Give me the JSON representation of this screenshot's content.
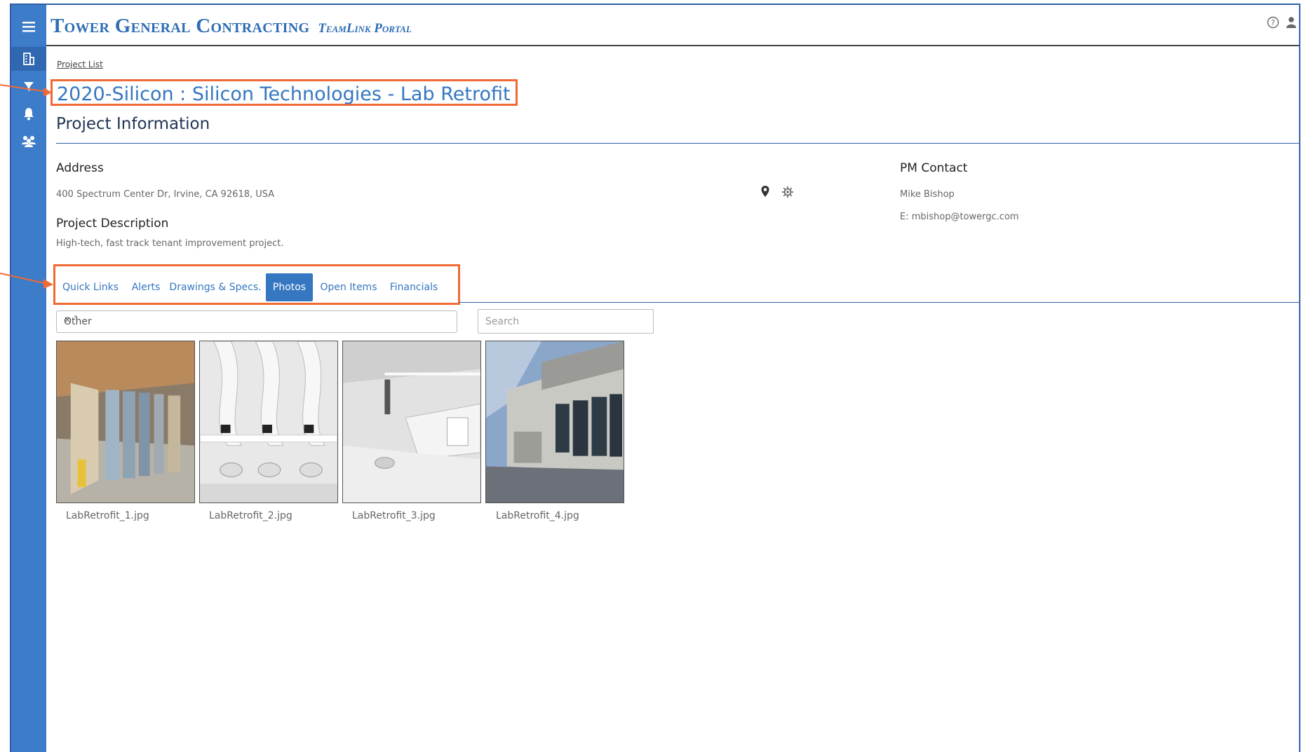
{
  "app": {
    "brand_main": "Tower General Contracting",
    "brand_sub": "TeamLink Portal"
  },
  "sidebar": {
    "items": [
      {
        "icon": "menu-icon"
      },
      {
        "icon": "building-icon",
        "active": true
      },
      {
        "icon": "filter-icon"
      },
      {
        "icon": "bell-icon"
      },
      {
        "icon": "users-icon"
      }
    ]
  },
  "header_icons": [
    "help-icon",
    "user-icon"
  ],
  "breadcrumb": "Project List",
  "project": {
    "title": "2020-Silicon : Silicon Technologies - Lab Retrofit",
    "section_title": "Project Information",
    "address_label": "Address",
    "address": "400 Spectrum Center Dr, Irvine, CA 92618, USA",
    "description_label": "Project Description",
    "description": "High-tech, fast track tenant improvement project.",
    "pm_label": "PM Contact",
    "pm_name": "Mike Bishop",
    "pm_email": "E: mbishop@towergc.com"
  },
  "tabs": [
    {
      "label": "Quick Links",
      "active": false
    },
    {
      "label": "Alerts",
      "active": false
    },
    {
      "label": "Drawings & Specs.",
      "active": false
    },
    {
      "label": "Photos",
      "active": true
    },
    {
      "label": "Open Items",
      "active": false
    },
    {
      "label": "Financials",
      "active": false
    }
  ],
  "filter": {
    "selected": "Other",
    "clear_symbol": "× ˅"
  },
  "search": {
    "placeholder": "Search"
  },
  "photos": [
    {
      "caption": "LabRetrofit_1.jpg"
    },
    {
      "caption": "LabRetrofit_2.jpg"
    },
    {
      "caption": "LabRetrofit_3.jpg"
    },
    {
      "caption": "LabRetrofit_4.jpg"
    }
  ],
  "colors": {
    "brand": "#2e6db4",
    "sidebar": "#3d7cc9",
    "highlight": "#f06a35",
    "tab_active": "#3577c0"
  }
}
